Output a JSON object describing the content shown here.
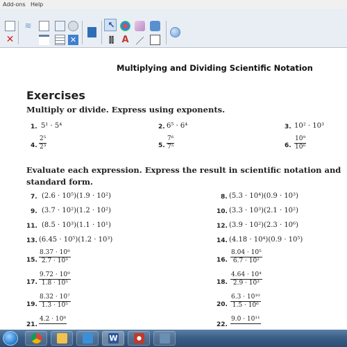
{
  "menubar": {
    "items": [
      "Add-ons",
      "Help"
    ]
  },
  "document": {
    "title": "Multiplying and Dividing Scientific Notation",
    "heading": "Exercises",
    "instruction1": "Multiply or divide. Express using exponents.",
    "instruction2_line1": "Evaluate each expression. Express the result in scientific notation and",
    "instruction2_line2": "standard form.",
    "ex1": {
      "n1": "1.",
      "e1": "5¹ · 5⁴",
      "n2": "2.",
      "e2": "6⁵ · 6⁴",
      "n3": "3.",
      "e3": "10² · 10³"
    },
    "ex2": {
      "n4": "4.",
      "f4n": "2⁵",
      "f4d": "2³",
      "n5": "5.",
      "f5n": "7⁶",
      "f5d": "7⁵",
      "n6": "6.",
      "f6n": "10⁹",
      "f6d": "10⁶"
    },
    "pairs": [
      {
        "ln": "7.",
        "le": "(2.6 · 10⁵)(1.9 · 10²)",
        "rn": "8.",
        "re": "(5.3 · 10⁴)(0.9 · 10³)"
      },
      {
        "ln": "9.",
        "le": "(3.7 · 10²)(1.2 · 10²)",
        "rn": "10.",
        "re": "(3.3 · 10³)(2.1 · 10²)"
      },
      {
        "ln": "11.",
        "le": "(8.5 · 10³)(1.1 · 10¹)",
        "rn": "12.",
        "re": "(3.9 · 10²)(2.3 · 10⁶)"
      },
      {
        "ln": "13.",
        "le": "(6.45 · 10⁵)(1.2 · 10³)",
        "rn": "14.",
        "re": "(4.18 · 10⁴)(0.9 · 10⁵)"
      }
    ],
    "fracs": [
      {
        "ln": "15.",
        "lnum": "8.37 · 10⁸",
        "lden": "2.7 · 10³",
        "rn": "16.",
        "rnum": "8.04 · 10⁵",
        "rden": "6.7 · 10²"
      },
      {
        "ln": "17.",
        "lnum": "9.72 · 10⁹",
        "lden": "1.8 · 10⁵",
        "rn": "18.",
        "rnum": "4.64 · 10⁴",
        "rden": "2.9 · 10³"
      },
      {
        "ln": "19.",
        "lnum": "8.32 · 10⁷",
        "lden": "1.3 · 10⁵",
        "rn": "20.",
        "rnum": "6.3 · 10¹⁰",
        "rden": "1.5 · 10⁶"
      },
      {
        "ln": "21.",
        "lnum": "4.2 · 10⁸",
        "lden": "",
        "rn": "22.",
        "rnum": "9.0 · 10¹¹",
        "rden": ""
      }
    ]
  },
  "taskbar": {
    "buttons": [
      {
        "name": "start-orb",
        "color": "#2f86d6"
      },
      {
        "name": "chrome-icon",
        "color": "#3aa757"
      },
      {
        "name": "file-explorer-icon",
        "color": "#f2c14e"
      },
      {
        "name": "journal-icon",
        "color": "#3b8fd9"
      },
      {
        "name": "word-icon",
        "color": "#2b579a"
      },
      {
        "name": "notebook-icon",
        "color": "#c0392b"
      },
      {
        "name": "screen-capture-icon",
        "color": "#6a8fb3"
      }
    ]
  }
}
